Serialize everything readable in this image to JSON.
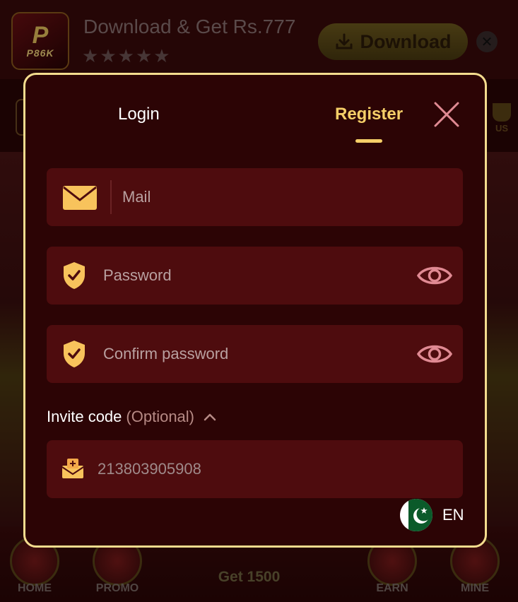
{
  "banner": {
    "app_name": "P86K",
    "title": "Download & Get Rs.777",
    "rating_stars": 5,
    "download_label": "Download",
    "close_symbol": "✕"
  },
  "background": {
    "bonus_label": "US",
    "nav": {
      "home": "HOME",
      "promo": "PROMO",
      "center": "Get 1500",
      "earn": "EARN",
      "mine": "MINE"
    }
  },
  "modal": {
    "tabs": {
      "login": "Login",
      "register": "Register",
      "active": "register"
    },
    "fields": {
      "mail_placeholder": "Mail",
      "password_placeholder": "Password",
      "confirm_placeholder": "Confirm password",
      "invite_label": "Invite code",
      "invite_optional": "(Optional)",
      "invite_value": "213803905908"
    },
    "language": {
      "code": "EN",
      "flag": "pakistan-flag"
    }
  },
  "colors": {
    "modal_bg": "#2c0405",
    "modal_border": "#f4dc8e",
    "field_bg": "#4e0c0e",
    "accent_gold": "#f6cf68",
    "eye_pink": "#e08a93"
  }
}
